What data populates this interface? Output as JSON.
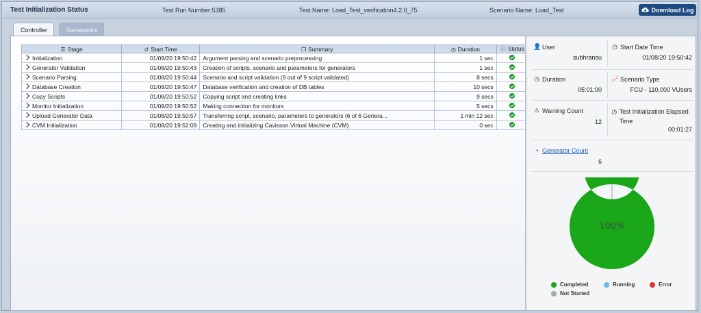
{
  "header": {
    "title": "Test Initialization Status",
    "test_run": "Test Run Number:5385",
    "test_name": "Test Name: Load_Test_verification4.2.0_75",
    "scenario": "Scenario Name: Load_Test",
    "download_label": "Download Log"
  },
  "tabs": [
    {
      "label": "Controller",
      "active": true
    },
    {
      "label": "Generators",
      "active": false
    }
  ],
  "table": {
    "columns": {
      "stage": "Stage",
      "start": "Start Time",
      "summary": "Summary",
      "duration": "Duration",
      "status": "Status"
    },
    "rows": [
      {
        "stage": "Initialization",
        "start": "01/08/20 19:50:42",
        "summary": "Argument parsing and scenario preprocessing",
        "duration": "1 sec"
      },
      {
        "stage": "Generator Validation",
        "start": "01/08/20 19:50:43",
        "summary": "Creation of scripts, scenario and parameters for generators",
        "duration": "1 sec"
      },
      {
        "stage": "Scenario Parsing",
        "start": "01/08/20 19:50:44",
        "summary": "Scenario and script validation (9 out of 9 script validated)",
        "duration": "8 secs"
      },
      {
        "stage": "Database Creation",
        "start": "01/08/20 19:50:47",
        "summary": "Database verification and creation of DB tables",
        "duration": "10 secs"
      },
      {
        "stage": "Copy Scripts",
        "start": "01/08/20 19:50:52",
        "summary": "Copying script and creating links",
        "duration": "9 secs"
      },
      {
        "stage": "Monitor Initialization",
        "start": "01/08/20 19:50:52",
        "summary": "Making connection for monitors",
        "duration": "5 secs"
      },
      {
        "stage": "Upload Generator Data",
        "start": "01/08/20 19:50:57",
        "summary": "Transferring script, scenario, parameters to generators (6 of 6 Genera...",
        "duration": "1 min 12 sec"
      },
      {
        "stage": "CVM Initialization",
        "start": "01/08/20 19:52:09",
        "summary": "Creating and initializing Cavisson Virtual Machine (CVM)",
        "duration": "0 sec"
      }
    ]
  },
  "side": {
    "user_label": "User",
    "user_value": "subhransu",
    "start_label": "Start Date Time",
    "start_value": "01/08/20 19:50:42",
    "duration_label": "Duration",
    "duration_value": "05:01:00",
    "scenario_type_label": "Scenario Type",
    "scenario_type_value": "FCU - 110,000 VUsers",
    "warning_label": "Warning Count",
    "warning_value": "12",
    "elapsed_label": "Test Initialization Elapsed Time",
    "elapsed_value": "00:01:27",
    "generator_label": "Generator Count",
    "generator_value": "6"
  },
  "chart_data": {
    "type": "pie",
    "center_label": "100%",
    "categories": [
      "Completed",
      "Running",
      "Error",
      "Not Started"
    ],
    "values": [
      100,
      0,
      0,
      0
    ],
    "colors": [
      "#1aa71a",
      "#6db8f0",
      "#e03030",
      "#a8a8a8"
    ]
  },
  "colors": {
    "accent": "#1d4a7f",
    "ok": "#1a9a2b"
  }
}
